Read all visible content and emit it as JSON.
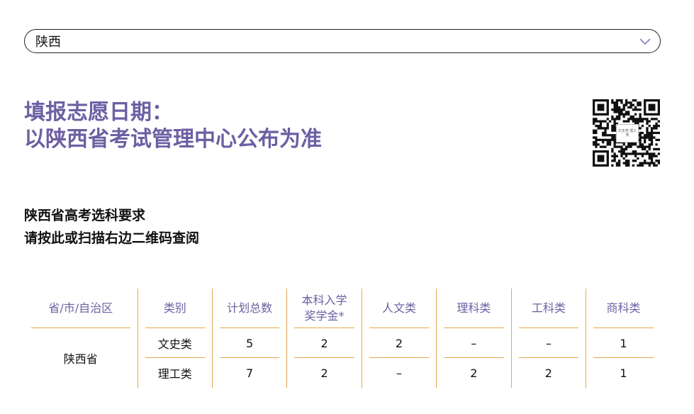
{
  "region_select": {
    "value": "陕西",
    "icon": "chevron-down-icon"
  },
  "deadline": {
    "line1": "填报志愿日期：",
    "line2": "以陕西省考试管理中心公布为准"
  },
  "qr": {
    "center_text": "文史类 理工类"
  },
  "note": {
    "line1": "陕西省高考选科要求",
    "line2": "请按此或扫描右边二维码查阅"
  },
  "table": {
    "headers": [
      "省/市/自治区",
      "类别",
      "计划总数",
      "本科入学奖学金*",
      "人文类",
      "理科类",
      "工科类",
      "商科类"
    ],
    "province": "陕西省",
    "rows": [
      {
        "category": "文史类",
        "cells": [
          "5",
          "2",
          "2",
          "–",
          "–",
          "1"
        ]
      },
      {
        "category": "理工类",
        "cells": [
          "7",
          "2",
          "–",
          "2",
          "2",
          "1"
        ]
      }
    ]
  },
  "colors": {
    "accent": "#6d5fa3",
    "rule": "#e2a84a"
  }
}
